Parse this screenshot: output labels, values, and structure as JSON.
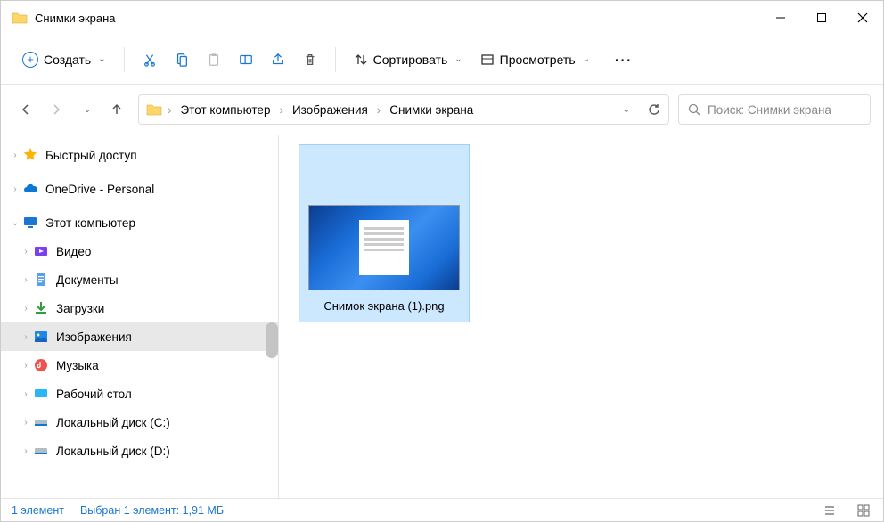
{
  "window": {
    "title": "Снимки экрана"
  },
  "toolbar": {
    "new": "Создать",
    "sort": "Сортировать",
    "view": "Просмотреть"
  },
  "breadcrumb": [
    "Этот компьютер",
    "Изображения",
    "Снимки экрана"
  ],
  "search": {
    "placeholder": "Поиск: Снимки экрана"
  },
  "sidebar": {
    "quick": "Быстрый доступ",
    "onedrive": "OneDrive - Personal",
    "this_pc": "Этот компьютер",
    "items": [
      {
        "label": "Видео"
      },
      {
        "label": "Документы"
      },
      {
        "label": "Загрузки"
      },
      {
        "label": "Изображения",
        "active": true
      },
      {
        "label": "Музыка"
      },
      {
        "label": "Рабочий стол"
      },
      {
        "label": "Локальный диск (C:)"
      },
      {
        "label": "Локальный диск (D:)"
      }
    ]
  },
  "files": [
    {
      "name": "Снимок экрана (1).png"
    }
  ],
  "status": {
    "count": "1 элемент",
    "selection": "Выбран 1 элемент: 1,91 МБ"
  }
}
